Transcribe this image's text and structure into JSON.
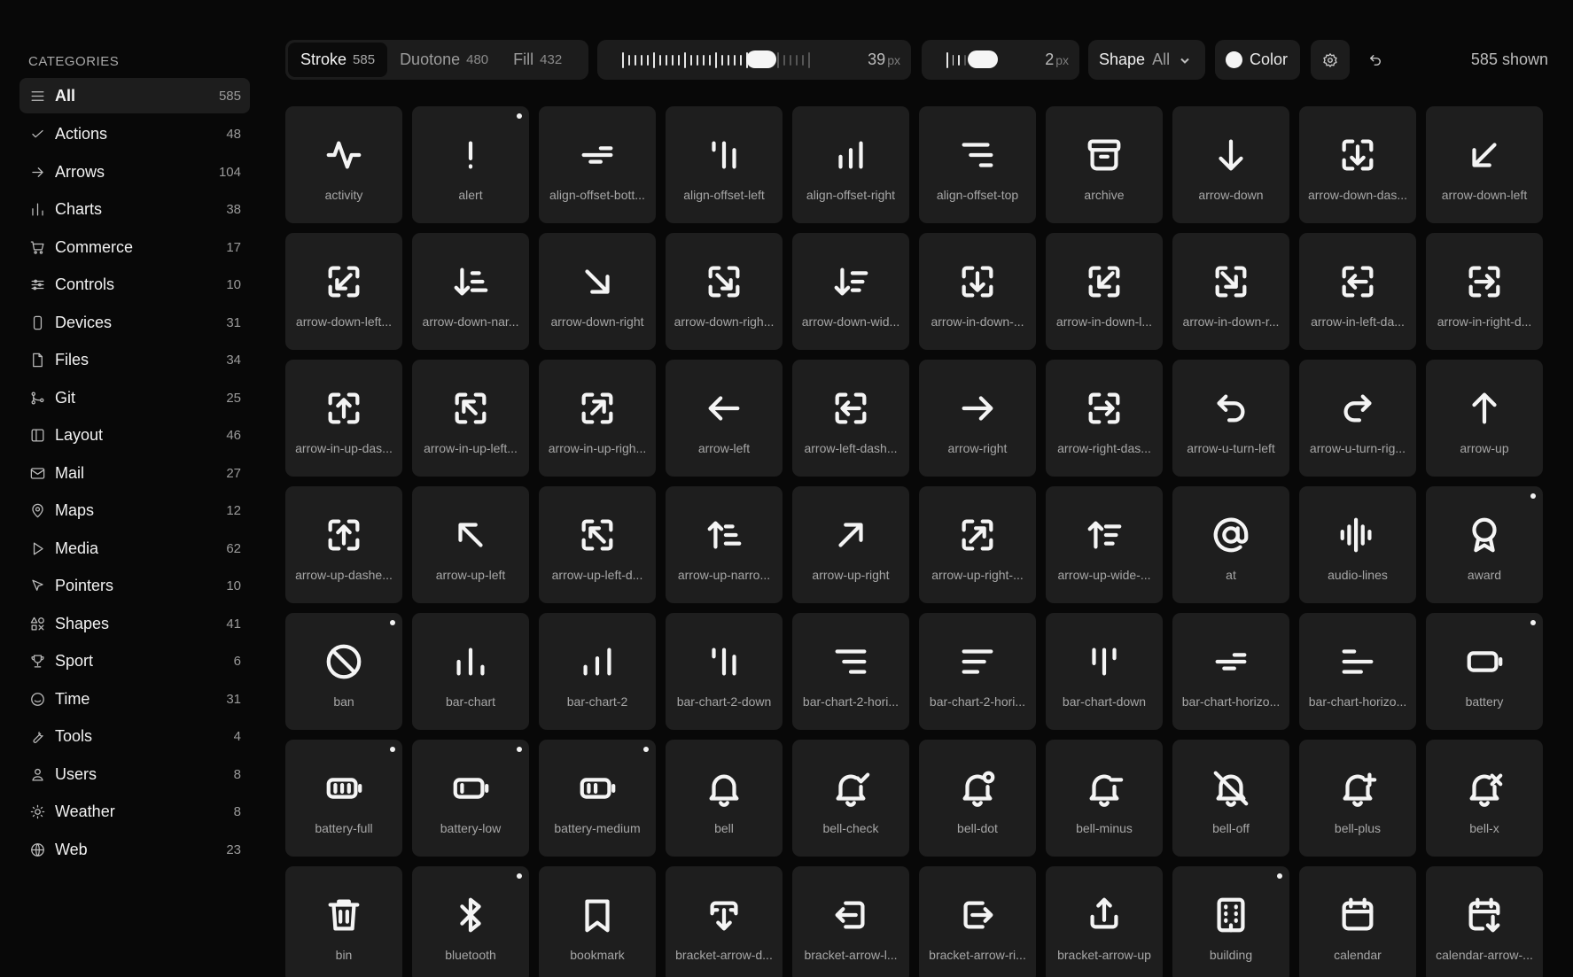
{
  "sidebar": {
    "heading": "CATEGORIES",
    "items": [
      {
        "label": "All",
        "count": "585",
        "icon": "menu-icon",
        "active": true
      },
      {
        "label": "Actions",
        "count": "48",
        "icon": "check-icon"
      },
      {
        "label": "Arrows",
        "count": "104",
        "icon": "arrow-right-icon"
      },
      {
        "label": "Charts",
        "count": "38",
        "icon": "bar-chart-icon"
      },
      {
        "label": "Commerce",
        "count": "17",
        "icon": "cart-icon"
      },
      {
        "label": "Controls",
        "count": "10",
        "icon": "sliders-icon"
      },
      {
        "label": "Devices",
        "count": "31",
        "icon": "phone-icon"
      },
      {
        "label": "Files",
        "count": "34",
        "icon": "file-icon"
      },
      {
        "label": "Git",
        "count": "25",
        "icon": "git-icon"
      },
      {
        "label": "Layout",
        "count": "46",
        "icon": "layout-icon"
      },
      {
        "label": "Mail",
        "count": "27",
        "icon": "mail-icon"
      },
      {
        "label": "Maps",
        "count": "12",
        "icon": "map-pin-icon"
      },
      {
        "label": "Media",
        "count": "62",
        "icon": "play-icon"
      },
      {
        "label": "Pointers",
        "count": "10",
        "icon": "pointer-icon"
      },
      {
        "label": "Shapes",
        "count": "41",
        "icon": "shapes-icon"
      },
      {
        "label": "Sport",
        "count": "6",
        "icon": "trophy-icon"
      },
      {
        "label": "Time",
        "count": "31",
        "icon": "clock-icon"
      },
      {
        "label": "Tools",
        "count": "4",
        "icon": "wrench-icon"
      },
      {
        "label": "Users",
        "count": "8",
        "icon": "user-icon"
      },
      {
        "label": "Weather",
        "count": "8",
        "icon": "sun-icon"
      },
      {
        "label": "Web",
        "count": "23",
        "icon": "globe-icon"
      }
    ]
  },
  "toolbar": {
    "styles": [
      {
        "label": "Stroke",
        "count": "585",
        "active": true
      },
      {
        "label": "Duotone",
        "count": "480"
      },
      {
        "label": "Fill",
        "count": "432"
      }
    ],
    "size_value": "39",
    "size_unit": "px",
    "size_level": 0.7,
    "stroke_value": "2",
    "stroke_unit": "px",
    "stroke_level": 0.35,
    "shape_label": "Shape",
    "shape_value": "All",
    "color_label": "Color",
    "color_value": "#f5f5f5",
    "shown_text": "585 shown"
  },
  "icons": [
    {
      "name": "activity",
      "g": "activity"
    },
    {
      "name": "alert",
      "g": "alert",
      "dot": true
    },
    {
      "name": "align-offset-bott...",
      "g": "align-bottom"
    },
    {
      "name": "align-offset-left",
      "g": "align-left"
    },
    {
      "name": "align-offset-right",
      "g": "align-right"
    },
    {
      "name": "align-offset-top",
      "g": "align-top"
    },
    {
      "name": "archive",
      "g": "archive"
    },
    {
      "name": "arrow-down",
      "g": "arrow-down"
    },
    {
      "name": "arrow-down-das...",
      "g": "dash-down"
    },
    {
      "name": "arrow-down-left",
      "g": "arrow-down-left"
    },
    {
      "name": "arrow-down-left...",
      "g": "dash-down-left"
    },
    {
      "name": "arrow-down-nar...",
      "g": "down-narrow"
    },
    {
      "name": "arrow-down-right",
      "g": "arrow-down-right"
    },
    {
      "name": "arrow-down-righ...",
      "g": "dash-down-right"
    },
    {
      "name": "arrow-down-wid...",
      "g": "down-wide"
    },
    {
      "name": "arrow-in-down-...",
      "g": "dash-down"
    },
    {
      "name": "arrow-in-down-l...",
      "g": "in-down-left"
    },
    {
      "name": "arrow-in-down-r...",
      "g": "in-down-right"
    },
    {
      "name": "arrow-in-left-da...",
      "g": "dash-left"
    },
    {
      "name": "arrow-in-right-d...",
      "g": "dash-right"
    },
    {
      "name": "arrow-in-up-das...",
      "g": "dash-up"
    },
    {
      "name": "arrow-in-up-left...",
      "g": "in-up-left"
    },
    {
      "name": "arrow-in-up-righ...",
      "g": "in-up-right"
    },
    {
      "name": "arrow-left",
      "g": "arrow-left"
    },
    {
      "name": "arrow-left-dash...",
      "g": "dash-left"
    },
    {
      "name": "arrow-right",
      "g": "arrow-right"
    },
    {
      "name": "arrow-right-das...",
      "g": "dash-right"
    },
    {
      "name": "arrow-u-turn-left",
      "g": "uturn-left"
    },
    {
      "name": "arrow-u-turn-rig...",
      "g": "uturn-right"
    },
    {
      "name": "arrow-up",
      "g": "arrow-up"
    },
    {
      "name": "arrow-up-dashe...",
      "g": "dash-up"
    },
    {
      "name": "arrow-up-left",
      "g": "arrow-up-left"
    },
    {
      "name": "arrow-up-left-d...",
      "g": "dash-up-left"
    },
    {
      "name": "arrow-up-narro...",
      "g": "up-narrow"
    },
    {
      "name": "arrow-up-right",
      "g": "arrow-up-right"
    },
    {
      "name": "arrow-up-right-...",
      "g": "dash-up-right"
    },
    {
      "name": "arrow-up-wide-...",
      "g": "up-wide"
    },
    {
      "name": "at",
      "g": "at"
    },
    {
      "name": "audio-lines",
      "g": "audio"
    },
    {
      "name": "award",
      "g": "award",
      "dot": true
    },
    {
      "name": "ban",
      "g": "ban",
      "dot": true
    },
    {
      "name": "bar-chart",
      "g": "bar-chart"
    },
    {
      "name": "bar-chart-2",
      "g": "bar-chart-2"
    },
    {
      "name": "bar-chart-2-down",
      "g": "align-left"
    },
    {
      "name": "bar-chart-2-hori...",
      "g": "hbars-1"
    },
    {
      "name": "bar-chart-2-hori...",
      "g": "hbars-2"
    },
    {
      "name": "bar-chart-down",
      "g": "bars-down"
    },
    {
      "name": "bar-chart-horizo...",
      "g": "align-bottom"
    },
    {
      "name": "bar-chart-horizo...",
      "g": "hbars-3"
    },
    {
      "name": "battery",
      "g": "battery",
      "dot": true
    },
    {
      "name": "battery-full",
      "g": "battery-full",
      "dot": true
    },
    {
      "name": "battery-low",
      "g": "battery-low",
      "dot": true
    },
    {
      "name": "battery-medium",
      "g": "battery-medium",
      "dot": true
    },
    {
      "name": "bell",
      "g": "bell"
    },
    {
      "name": "bell-check",
      "g": "bell-check"
    },
    {
      "name": "bell-dot",
      "g": "bell-dot"
    },
    {
      "name": "bell-minus",
      "g": "bell-minus"
    },
    {
      "name": "bell-off",
      "g": "bell-off"
    },
    {
      "name": "bell-plus",
      "g": "bell-plus"
    },
    {
      "name": "bell-x",
      "g": "bell-x"
    },
    {
      "name": "bin",
      "g": "bin"
    },
    {
      "name": "bluetooth",
      "g": "bluetooth",
      "dot": true
    },
    {
      "name": "bookmark",
      "g": "bookmark"
    },
    {
      "name": "bracket-arrow-d...",
      "g": "bracket-down"
    },
    {
      "name": "bracket-arrow-l...",
      "g": "bracket-left"
    },
    {
      "name": "bracket-arrow-ri...",
      "g": "bracket-right"
    },
    {
      "name": "bracket-arrow-up",
      "g": "bracket-up"
    },
    {
      "name": "building",
      "g": "building",
      "dot": true
    },
    {
      "name": "calendar",
      "g": "calendar"
    },
    {
      "name": "calendar-arrow-...",
      "g": "calendar-arrow"
    }
  ]
}
